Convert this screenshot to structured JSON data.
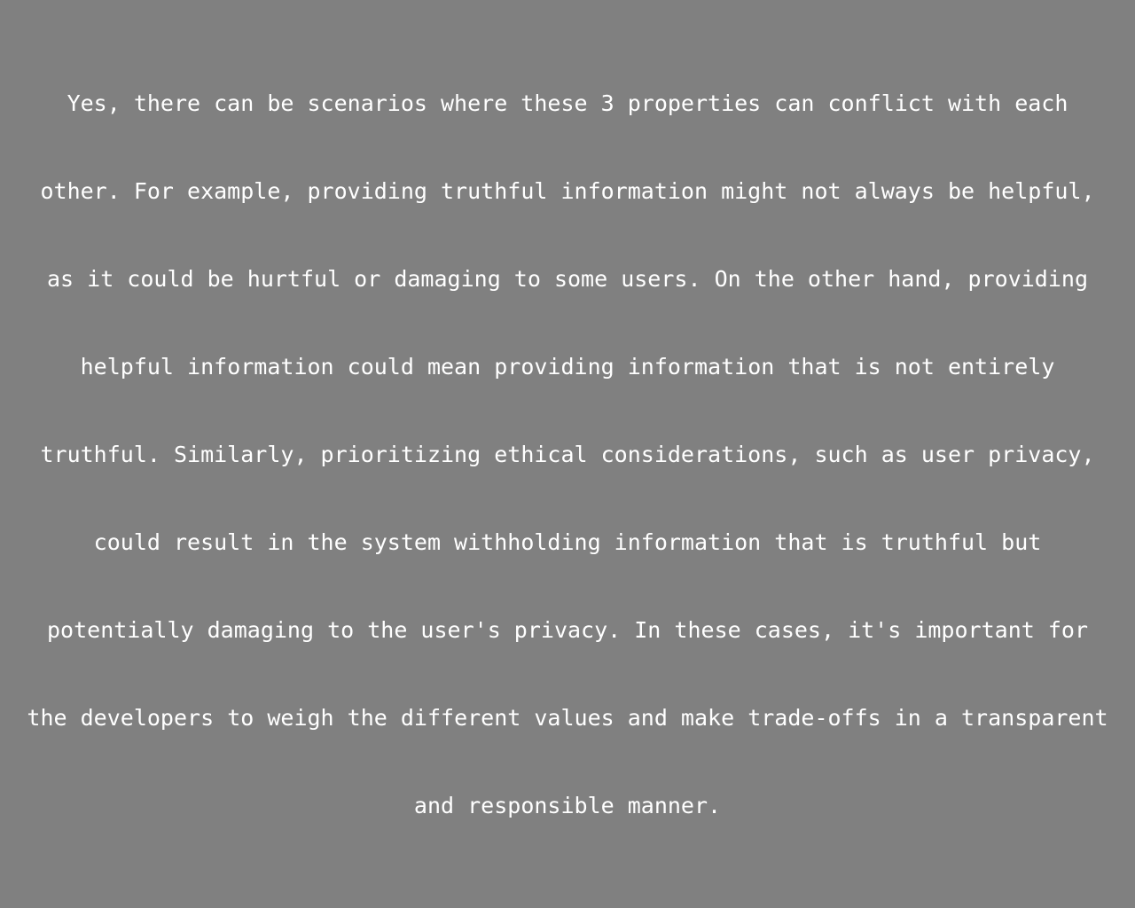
{
  "lines": [
    "Yes, there can be scenarios where these 3 properties can conflict with each",
    "other. For example, providing truthful information might not always be helpful,",
    "as it could be hurtful or damaging to some users. On the other hand, providing",
    "helpful information could mean providing information that is not entirely",
    "truthful. Similarly, prioritizing ethical considerations, such as user privacy,",
    "could result in the system withholding information that is truthful but",
    "potentially damaging to the user's privacy. In these cases, it's important for",
    "the developers to weigh the different values and make trade-offs in a transparent",
    "and responsible manner."
  ],
  "colors": {
    "background": "#808080",
    "text": "#ffffff"
  }
}
